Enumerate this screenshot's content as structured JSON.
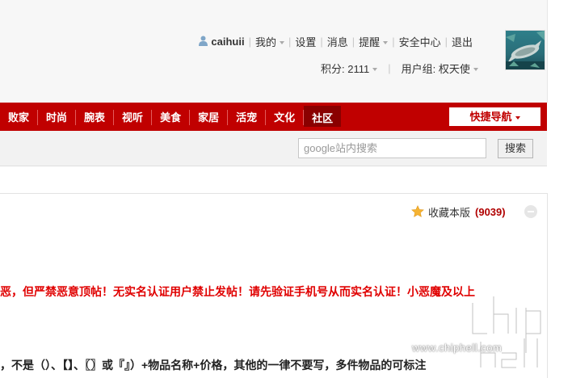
{
  "user_bar": {
    "username": "caihuii",
    "my_label": "我的",
    "settings_label": "设置",
    "messages_label": "消息",
    "reminders_label": "提醒",
    "security_label": "安全中心",
    "logout_label": "退出"
  },
  "stats_bar": {
    "points_label": "积分: 2111",
    "usergroup_label": "用户组: 权天使"
  },
  "nav": {
    "items": [
      "败家",
      "时尚",
      "腕表",
      "视听",
      "美食",
      "家居",
      "活宠",
      "文化",
      "社区"
    ],
    "active_item": "社区",
    "quick_nav_label": "快捷导航"
  },
  "search": {
    "placeholder": "google站内搜索",
    "button_label": "搜索"
  },
  "forum": {
    "favorite_label": "收藏本版",
    "favorite_count": "(9039)",
    "notice_red": "恶，但严禁恶意顶帖！无实名认证用户禁止发帖！请先验证手机号从而实名认证！小恶魔及以上",
    "notice_black": "，不是（）、【】、〖〗或『』）+物品名称+价格，其他的一律不要写，多件物品的可标注"
  },
  "watermark": {
    "url_text": "www.chiphell.com"
  },
  "colors": {
    "nav_red": "#c00000",
    "nav_active": "#8a0000",
    "notice_red": "#e00000",
    "count_red": "#b00000"
  },
  "icons": {
    "user": "user-icon",
    "star": "star-icon",
    "collapse": "collapse-icon"
  }
}
